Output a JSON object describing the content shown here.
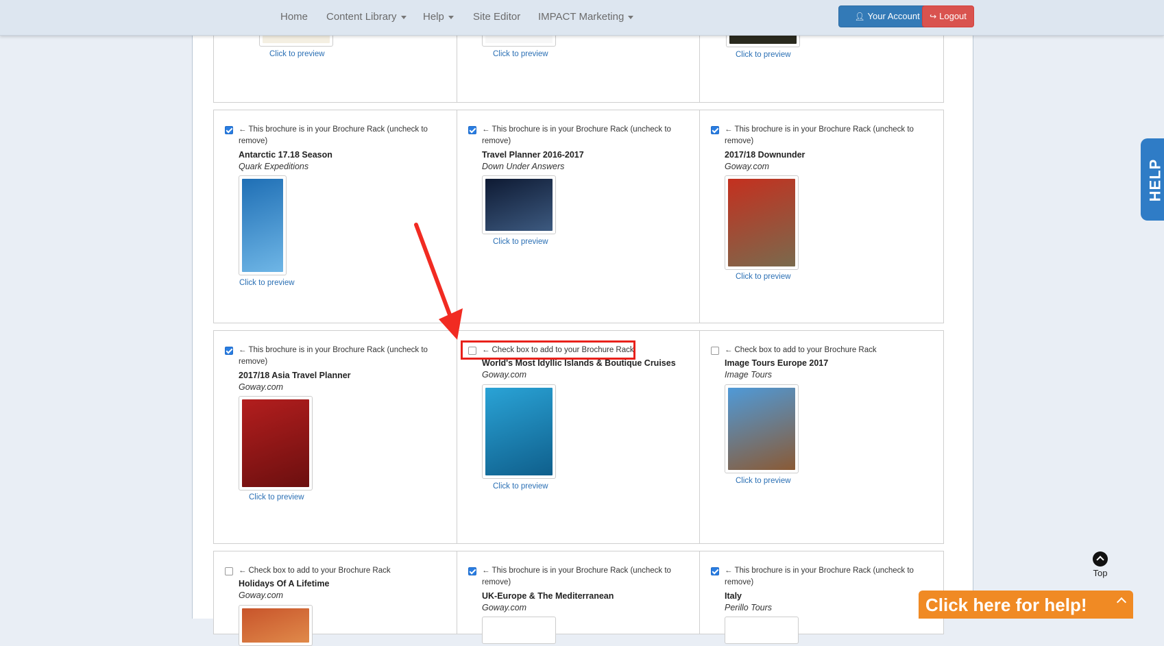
{
  "nav": {
    "items": [
      {
        "label": "Home",
        "dropdown": false
      },
      {
        "label": "Content Library",
        "dropdown": true
      },
      {
        "label": "Help",
        "dropdown": true
      },
      {
        "label": "Site Editor",
        "dropdown": false
      },
      {
        "label": "IMPACT Marketing",
        "dropdown": true
      }
    ],
    "account_label": "Your Account",
    "logout_label": "Logout"
  },
  "top_row": {
    "preview_labels": [
      "Click to preview",
      "Click to preview",
      "Click to preview"
    ]
  },
  "brochures": [
    {
      "checked": true,
      "status": "This brochure is in your Brochure Rack (uncheck to remove)",
      "title": "Antarctic 17.18 Season",
      "publisher": "Quark Expeditions",
      "preview": "Click to preview",
      "cover": [
        "#1f6fb5",
        "#6fb6e6"
      ]
    },
    {
      "checked": true,
      "status": "This brochure is in your Brochure Rack (uncheck to remove)",
      "title": "Travel Planner 2016-2017",
      "publisher": "Down Under Answers",
      "preview": "Click to preview",
      "cover": [
        "#0e1a33",
        "#3d5a80"
      ]
    },
    {
      "checked": true,
      "status": "This brochure is in your Brochure Rack (uncheck to remove)",
      "title": "2017/18 Downunder",
      "publisher": "Goway.com",
      "preview": "Click to preview",
      "cover": [
        "#c4301f",
        "#7a6a4d"
      ]
    },
    {
      "checked": true,
      "status": "This brochure is in your Brochure Rack (uncheck to remove)",
      "title": "2017/18 Asia Travel Planner",
      "publisher": "Goway.com",
      "preview": "Click to preview",
      "cover": [
        "#b31e1e",
        "#6b0f0f"
      ]
    },
    {
      "checked": false,
      "status": "Check box to add to your Brochure Rack",
      "title": "World's Most Idyllic Islands & Boutique Cruises",
      "publisher": "Goway.com",
      "preview": "Click to preview",
      "cover": [
        "#2aa3d6",
        "#0f5f8c"
      ]
    },
    {
      "checked": false,
      "status": "Check box to add to your Brochure Rack",
      "title": "Image Tours Europe 2017",
      "publisher": "Image Tours",
      "preview": "Click to preview",
      "cover": [
        "#4f9ad8",
        "#8a5a35"
      ]
    },
    {
      "checked": false,
      "status": "Check box to add to your Brochure Rack",
      "title": "Holidays Of A Lifetime",
      "publisher": "Goway.com",
      "preview": "",
      "cover": [
        "#c8542b",
        "#e08a4a"
      ]
    },
    {
      "checked": true,
      "status": "This brochure is in your Brochure Rack (uncheck to remove)",
      "title": "UK-Europe & The Mediterranean",
      "publisher": "Goway.com",
      "preview": "",
      "cover": [
        "#ffffff",
        "#ffffff"
      ]
    },
    {
      "checked": true,
      "status": "This brochure is in your Brochure Rack (uncheck to remove)",
      "title": "Italy",
      "publisher": "Perillo Tours",
      "preview": "",
      "cover": [
        "#ffffff",
        "#ffffff"
      ]
    }
  ],
  "help_tab_label": "HELP",
  "top_label": "Top",
  "help_bar_label": "Click here for help!"
}
